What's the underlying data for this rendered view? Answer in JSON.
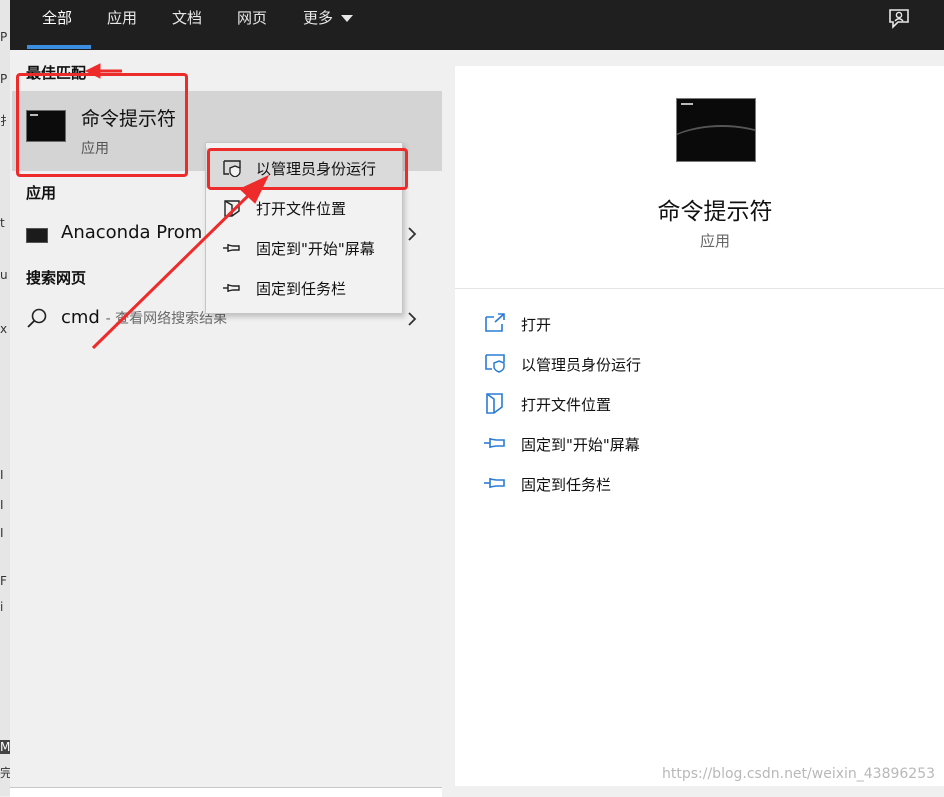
{
  "tabs": [
    {
      "label": "全部",
      "active": true
    },
    {
      "label": "应用"
    },
    {
      "label": "文档"
    },
    {
      "label": "网页"
    },
    {
      "label": "更多"
    }
  ],
  "sections": {
    "best_match": "最佳匹配",
    "apps": "应用",
    "web_search": "搜索网页"
  },
  "best_match": {
    "title": "命令提示符",
    "subtitle": "应用"
  },
  "apps": [
    {
      "label": "Anaconda Prom"
    }
  ],
  "web_search": {
    "query": "cmd",
    "hint": "- 查看网络搜索结果"
  },
  "context_menu": [
    {
      "label": "以管理员身份运行",
      "icon": "shield-icon",
      "highlighted": true
    },
    {
      "label": "打开文件位置",
      "icon": "folder-open-icon"
    },
    {
      "label": "固定到\"开始\"屏幕",
      "icon": "pin-icon"
    },
    {
      "label": "固定到任务栏",
      "icon": "pin-icon"
    }
  ],
  "preview": {
    "title": "命令提示符",
    "subtitle": "应用",
    "actions": [
      {
        "label": "打开",
        "icon": "open-icon"
      },
      {
        "label": "以管理员身份运行",
        "icon": "shield-icon"
      },
      {
        "label": "打开文件位置",
        "icon": "folder-open-icon"
      },
      {
        "label": "固定到\"开始\"屏幕",
        "icon": "pin-icon"
      },
      {
        "label": "固定到任务栏",
        "icon": "pin-icon"
      }
    ]
  },
  "left_edge_fragments": [
    "P",
    "P",
    "扌",
    "t",
    "u",
    "x",
    "I",
    "I",
    "I",
    "F",
    "i",
    "M",
    "完"
  ],
  "watermark": "https://blog.csdn.net/weixin_43896253",
  "colors": {
    "topbar": "#1f1f1f",
    "accent": "#3b8ee0",
    "annotation": "#ee2b2b",
    "icon_blue": "#2a7bd6"
  }
}
